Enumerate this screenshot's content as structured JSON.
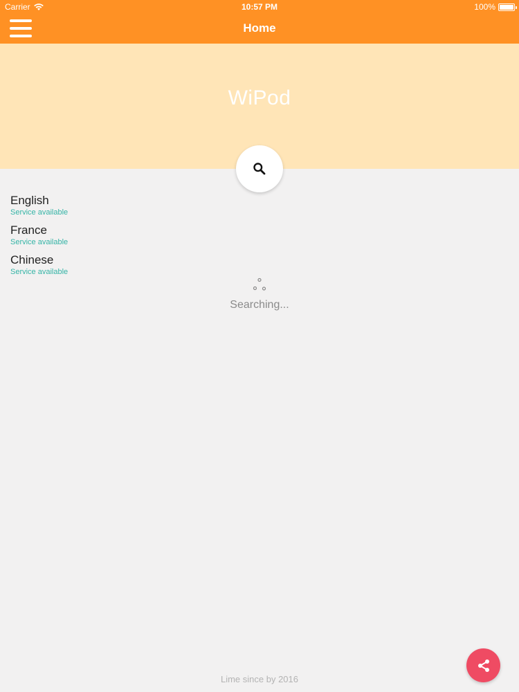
{
  "status_bar": {
    "carrier": "Carrier",
    "time": "10:57 PM",
    "battery": "100%"
  },
  "nav": {
    "title": "Home",
    "menu_icon": "hamburger-menu-icon"
  },
  "banner": {
    "app_name": "WiPod",
    "search_icon": "search-icon"
  },
  "languages": [
    {
      "name": "English",
      "status": "Service available"
    },
    {
      "name": "France",
      "status": "Service available"
    },
    {
      "name": "Chinese",
      "status": "Service available"
    }
  ],
  "loader": {
    "text": "Searching..."
  },
  "footer": {
    "text": "Lime since by 2016",
    "share_icon": "share-icon"
  },
  "colors": {
    "nav_bar": "#ff9124",
    "banner": "#ffe5b7",
    "background": "#f2f1f1",
    "status_available": "#35b4a6",
    "share_button": "#ef4b63"
  }
}
